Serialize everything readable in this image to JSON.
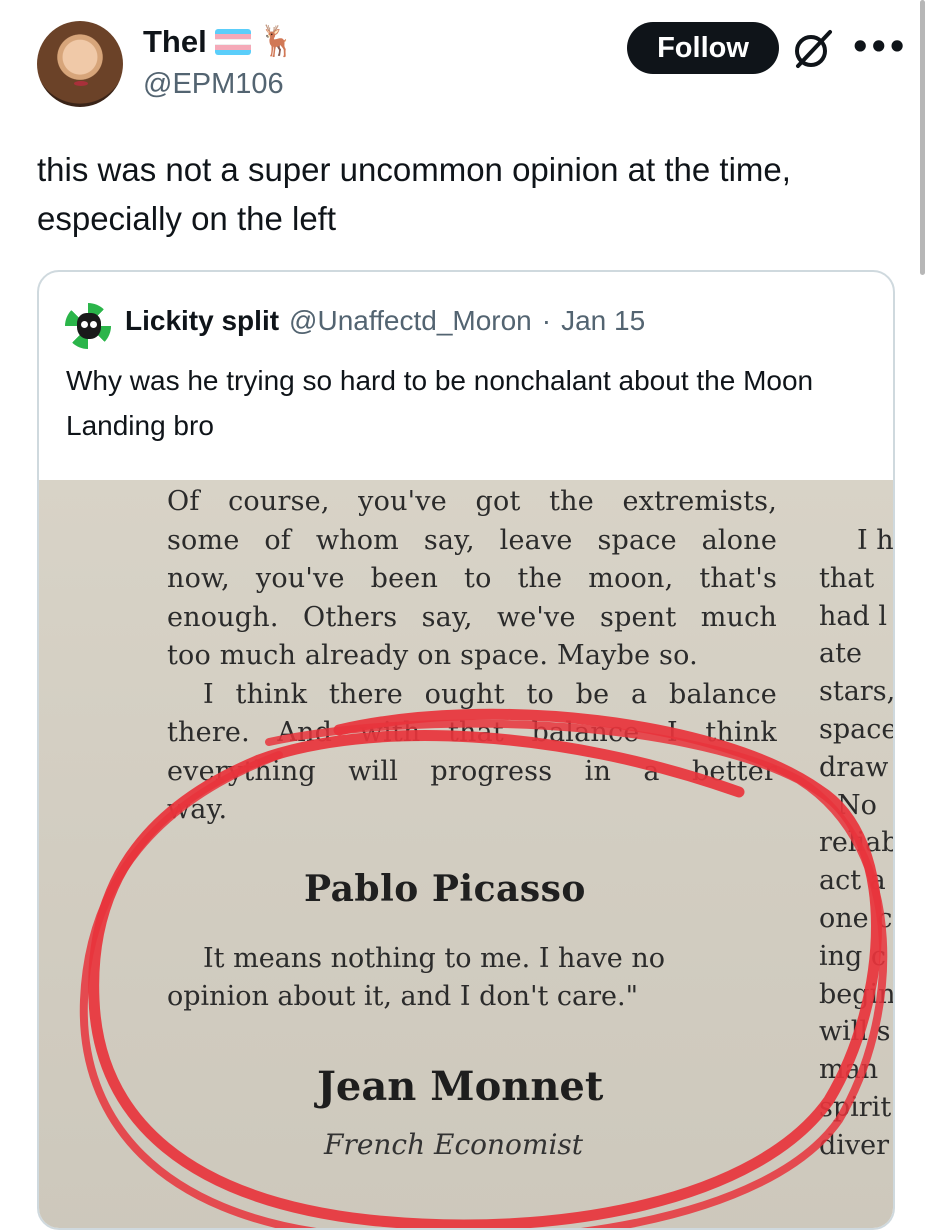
{
  "author": {
    "name": "Thel",
    "handle": "@EPM106",
    "flag_colors": [
      "#5bcefa",
      "#f5a9b8",
      "#ffffff",
      "#f5a9b8",
      "#5bcefa"
    ],
    "emoji_icon": "deer-icon"
  },
  "actions": {
    "follow_label": "Follow",
    "grok_icon": "grok-icon",
    "more_icon": "more-icon"
  },
  "tweet": {
    "text": "this was not a super uncommon opinion at the time, especially on the left"
  },
  "quoted": {
    "name": "Lickity split",
    "handle": "@Unaffectd_Moron",
    "separator": "·",
    "date": "Jan 15",
    "text": "Why was he trying so hard to be nonchalant about the Moon Landing bro",
    "photo": {
      "paragraph_lines": [
        "Of course, you've got the extremists,",
        "some of whom say, leave space alone",
        "now, you've been to the moon, that's",
        "enough. Others say, we've spent much",
        "too much already on space. Maybe so.",
        "I think there ought to be a balance",
        "there. And with that balance I think",
        "everything will progress in a better",
        "way."
      ],
      "right_column_lines": [
        "I h",
        "that",
        "had l",
        "ate",
        "stars,",
        "space",
        "draw",
        "No",
        "reliab",
        "act a",
        "one c",
        "ing c",
        "begin",
        "will s",
        "man",
        "spirit",
        "diver"
      ],
      "heading_1": "Pablo Picasso",
      "quote_lines": [
        "It means nothing to me. I have no",
        "opinion about it, and I don't care.\""
      ],
      "heading_2": "Jean Monnet",
      "subtitle": "French Economist",
      "circle_color": "#e8343c"
    }
  }
}
